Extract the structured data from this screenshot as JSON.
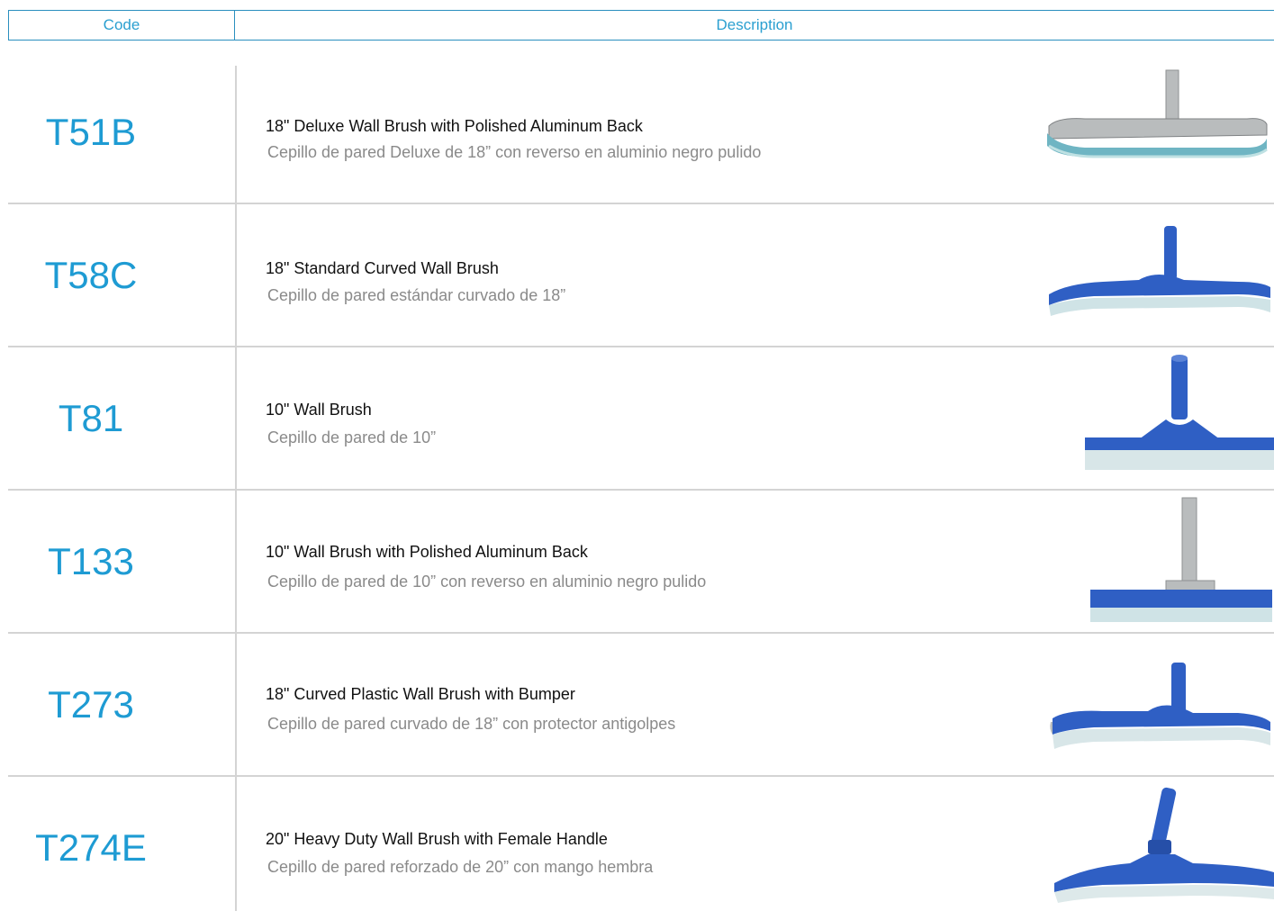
{
  "header": {
    "code_label": "Code",
    "description_label": "Description"
  },
  "colors": {
    "accent": "#2a8fbf",
    "code_text": "#1e9bd3",
    "brush_blue": "#2f5fc4",
    "bristle": "#bfe1e3",
    "aluminum": "#b9bcbd"
  },
  "rows": [
    {
      "code": "T51B",
      "title": "18\" Deluxe Wall Brush with Polished Aluminum Back",
      "subtitle": "Cepillo de pared Deluxe de 18” con reverso en aluminio negro pulido",
      "icon": "curved-aluminum-wall-brush-icon"
    },
    {
      "code": "T58C",
      "title": "18\" Standard Curved Wall Brush",
      "subtitle": "Cepillo de pared estándar curvado de 18”",
      "icon": "curved-wall-brush-icon"
    },
    {
      "code": "T81",
      "title": "10\" Wall Brush",
      "subtitle": "Cepillo de pared de 10”",
      "icon": "straight-wall-brush-icon"
    },
    {
      "code": "T133",
      "title": "10\" Wall Brush with Polished Aluminum Back",
      "subtitle": "Cepillo de pared de 10” con reverso en aluminio negro pulido",
      "icon": "aluminum-back-wall-brush-icon"
    },
    {
      "code": "T273",
      "title": "18\" Curved Plastic Wall Brush with Bumper",
      "subtitle": "Cepillo de pared curvado de 18” con protector antigolpes",
      "icon": "curved-bumper-wall-brush-icon"
    },
    {
      "code": "T274E",
      "title": "20\" Heavy Duty Wall Brush with Female Handle",
      "subtitle": "Cepillo de pared reforzado de 20” con mango hembra",
      "icon": "heavy-duty-wall-brush-icon"
    }
  ]
}
